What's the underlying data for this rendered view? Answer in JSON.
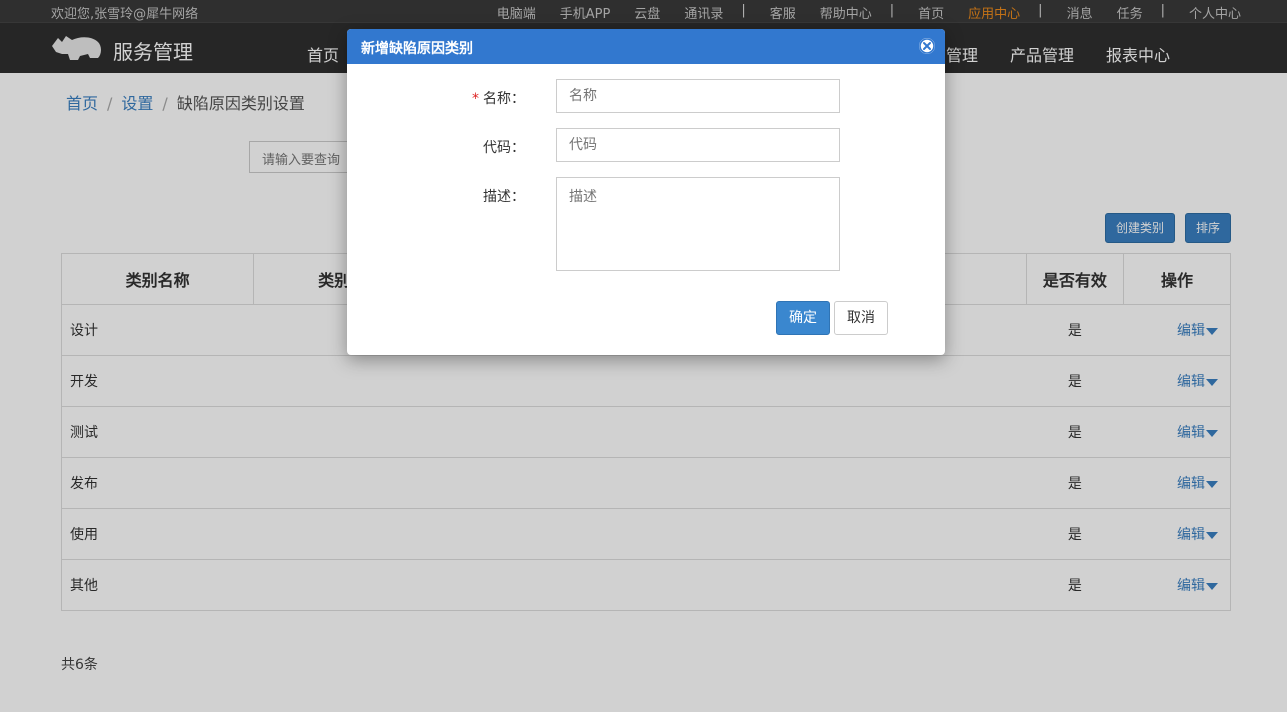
{
  "topbar": {
    "welcome": "欢迎您,张雪玲@犀牛网络",
    "links": [
      "电脑端",
      "手机APP",
      "云盘",
      "通讯录",
      "客服",
      "帮助中心",
      "首页",
      "应用中心",
      "消息",
      "任务",
      "个人中心"
    ],
    "separator": "|"
  },
  "header": {
    "brand": "服务管理",
    "nav": [
      "首页",
      "管理",
      "产品管理",
      "报表中心"
    ]
  },
  "breadcrumb": {
    "home": "首页",
    "settings": "设置",
    "current": "缺陷原因类别设置",
    "sep": "/"
  },
  "search": {
    "placeholder": "请输入要查询"
  },
  "toolbar": {
    "create_label": "创建类别",
    "sort_label": "排序"
  },
  "table": {
    "headers": [
      "类别名称",
      "类别",
      "是否有效",
      "操作"
    ],
    "rows": [
      {
        "name": "设计",
        "valid": "是",
        "action": "编辑"
      },
      {
        "name": "开发",
        "valid": "是",
        "action": "编辑"
      },
      {
        "name": "测试",
        "valid": "是",
        "action": "编辑"
      },
      {
        "name": "发布",
        "valid": "是",
        "action": "编辑"
      },
      {
        "name": "使用",
        "valid": "是",
        "action": "编辑"
      },
      {
        "name": "其他",
        "valid": "是",
        "action": "编辑"
      }
    ]
  },
  "footer": {
    "total": "共6条"
  },
  "modal": {
    "title": "新增缺陷原因类别",
    "name_label": "名称：",
    "name_placeholder": "名称",
    "code_label": "代码：",
    "code_placeholder": "代码",
    "desc_label": "描述：",
    "desc_placeholder": "描述",
    "required_mark": "*",
    "confirm_label": "确定",
    "cancel_label": "取消"
  },
  "colors": {
    "accent": "#3278cf",
    "brand_orange": "#f08c1c",
    "header_bg": "#2f2f2f"
  }
}
